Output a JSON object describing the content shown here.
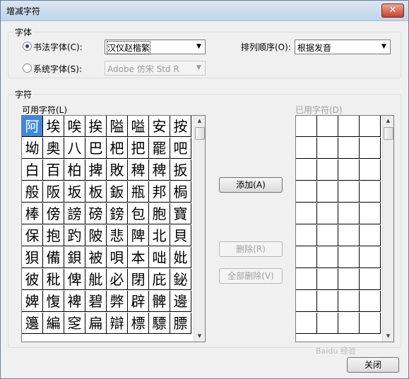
{
  "window": {
    "title": "增减字符",
    "close_glyph": "✕"
  },
  "font_group": {
    "label": "字体",
    "calligraphy_radio": {
      "label": "书法字体(C):",
      "checked": true
    },
    "calligraphy_combo": {
      "value": "汉仪赵楷繁"
    },
    "sort_label": "排列顺序(O):",
    "sort_combo": {
      "value": "根据发音"
    },
    "system_radio": {
      "label": "系统字体(S):",
      "checked": false
    },
    "system_combo": {
      "value": "Adobe 仿宋 Std R"
    }
  },
  "chars_group": {
    "label": "字符",
    "available_label": "可用字符(L)",
    "used_label": "已用字符(D)",
    "available_chars": [
      [
        "阿",
        "埃",
        "唉",
        "挨",
        "隘",
        "嗌",
        "安",
        "按"
      ],
      [
        "坳",
        "奥",
        "八",
        "巴",
        "杷",
        "把",
        "罷",
        "吧"
      ],
      [
        "白",
        "百",
        "柏",
        "捭",
        "敗",
        "稗",
        "稗",
        "扳"
      ],
      [
        "般",
        "阪",
        "坂",
        "板",
        "鈑",
        "瓶",
        "邦",
        "梮"
      ],
      [
        "棒",
        "傍",
        "謗",
        "磅",
        "鎊",
        "包",
        "胞",
        "寶"
      ],
      [
        "保",
        "抱",
        "趵",
        "陂",
        "悲",
        "陴",
        "北",
        "貝"
      ],
      [
        "狽",
        "備",
        "鋇",
        "被",
        "唄",
        "本",
        "咄",
        "妣"
      ],
      [
        "彼",
        "秕",
        "俾",
        "舭",
        "必",
        "閉",
        "庇",
        "鉍"
      ],
      [
        "婢",
        "愎",
        "裨",
        "碧",
        "弊",
        "辟",
        "髀",
        "邊"
      ],
      [
        "籩",
        "編",
        "窆",
        "扁",
        "辯",
        "標",
        "驃",
        "膘"
      ]
    ],
    "used_chars_rows": 10,
    "used_chars_cols": 4
  },
  "buttons": {
    "add": "添加(A)",
    "delete": "删除(R)",
    "delete_all": "全部删除(V)",
    "close": "关闭"
  },
  "watermark": "Baidu 经验"
}
